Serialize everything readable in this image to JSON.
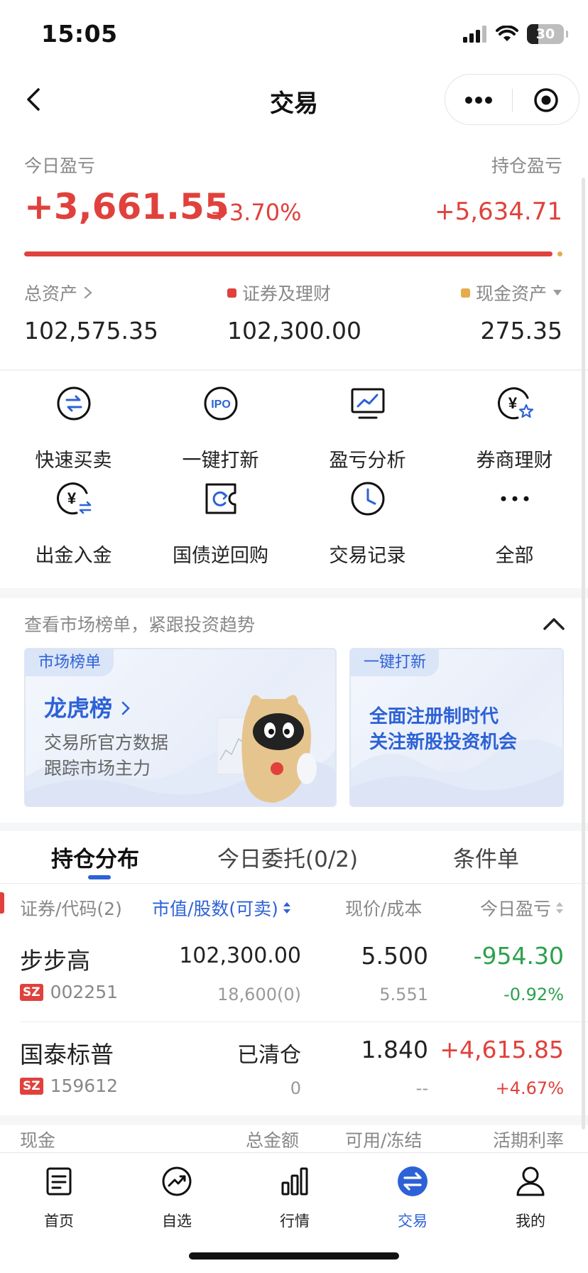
{
  "status_bar": {
    "time": "15:05",
    "battery": "30",
    "battery_level_percent": 30
  },
  "nav": {
    "title": "交易"
  },
  "summary": {
    "today_pnl_label": "今日盈亏",
    "today_pnl_value": "+3,661.55",
    "today_pnl_pct": "+3.70%",
    "hold_pnl_label": "持仓盈亏",
    "hold_pnl_value": "+5,634.71",
    "total_assets_label": "总资产",
    "total_assets_value": "102,575.35",
    "securities_label": "证券及理财",
    "securities_value": "102,300.00",
    "cash_label": "现金资产",
    "cash_value": "275.35",
    "colors": {
      "securities": "#e0413c",
      "cash": "#e3ad4c"
    }
  },
  "functions": [
    {
      "label": "快速买卖",
      "icon": "swap-arrows-icon"
    },
    {
      "label": "一键打新",
      "icon": "ipo-icon"
    },
    {
      "label": "盈亏分析",
      "icon": "chart-monitor-icon"
    },
    {
      "label": "券商理财",
      "icon": "yuan-star-icon"
    },
    {
      "label": "出金入金",
      "icon": "yuan-transfer-icon"
    },
    {
      "label": "国债逆回购",
      "icon": "bond-ticket-icon"
    },
    {
      "label": "交易记录",
      "icon": "clock-icon"
    },
    {
      "label": "全部",
      "icon": "more-dots-icon"
    }
  ],
  "market": {
    "hint": "查看市场榜单，紧跟投资趋势",
    "left_card": {
      "tag": "市场榜单",
      "title": "龙虎榜",
      "line1": "交易所官方数据",
      "line2": "跟踪市场主力"
    },
    "right_card": {
      "tag": "一键打新",
      "line1": "全面注册制时代",
      "line2": "关注新股投资机会"
    }
  },
  "tabs": [
    "持仓分布",
    "今日委托(0/2)",
    "条件单"
  ],
  "table": {
    "headers": {
      "security": "证券/代码(2)",
      "value": "市值/股数(可卖)",
      "price": "现价/成本",
      "pnl": "今日盈亏"
    },
    "rows": [
      {
        "name": "步步高",
        "market": "SZ",
        "code": "002251",
        "value": "102,300.00",
        "qty": "18,600(0)",
        "price": "5.500",
        "cost": "5.551",
        "pnl": "-954.30",
        "pnl_pct": "-0.92%"
      },
      {
        "name": "国泰标普",
        "market": "SZ",
        "code": "159612",
        "value": "已清仓",
        "qty": "0",
        "price": "1.840",
        "cost": "--",
        "pnl": "+4,615.85",
        "pnl_pct": "+4.67%"
      }
    ]
  },
  "cash_headers": {
    "name": "现金",
    "total": "总金额",
    "avail": "可用/冻结",
    "rate": "活期利率"
  },
  "tabbar": [
    {
      "label": "首页",
      "icon": "home-doc-icon"
    },
    {
      "label": "自选",
      "icon": "trend-circle-icon"
    },
    {
      "label": "行情",
      "icon": "bar-chart-icon"
    },
    {
      "label": "交易",
      "icon": "exchange-circle-icon",
      "active": true
    },
    {
      "label": "我的",
      "icon": "user-icon"
    }
  ]
}
